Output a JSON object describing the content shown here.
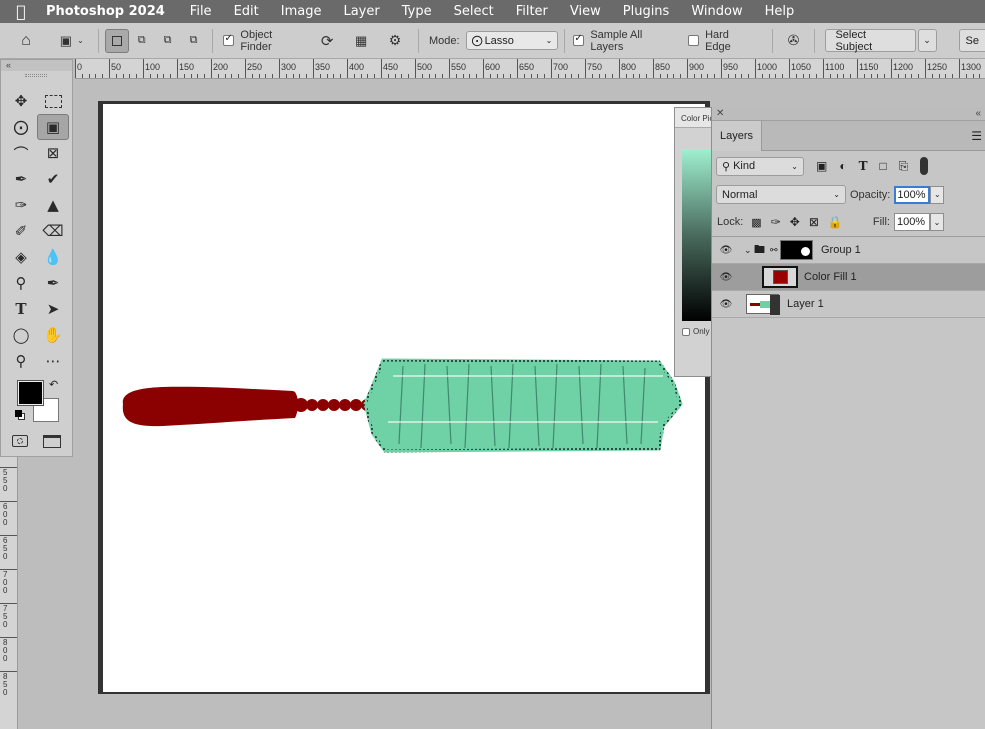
{
  "menubar": {
    "app": "Photoshop 2024",
    "items": [
      "File",
      "Edit",
      "Image",
      "Layer",
      "Type",
      "Select",
      "Filter",
      "View",
      "Plugins",
      "Window",
      "Help"
    ]
  },
  "options": {
    "object_finder_label": "Object Finder",
    "mode_label": "Mode:",
    "mode_value": "Lasso",
    "sample_all_layers_label": "Sample All Layers",
    "hard_edge_label": "Hard Edge",
    "select_subject_label": "Select Subject",
    "se_label": "Se"
  },
  "ruler": {
    "top_labels": [
      "0",
      "50",
      "100",
      "150",
      "200",
      "250",
      "300",
      "350",
      "400",
      "450",
      "500",
      "550",
      "600",
      "650",
      "700",
      "750",
      "800",
      "850",
      "900",
      "950",
      "1000",
      "1050",
      "1100",
      "1150",
      "1200",
      "1250",
      "1300"
    ],
    "left_labels": [
      "5 5 0",
      "6 0 0",
      "6 5 0",
      "7 0 0",
      "7 5 0",
      "8 0 0",
      "8 5 0"
    ]
  },
  "color_picker": {
    "title": "Color Picker",
    "only_label": "Only"
  },
  "layers": {
    "tab": "Layers",
    "kind_label": "Kind",
    "blend_mode": "Normal",
    "opacity_label": "Opacity:",
    "opacity_value": "100%",
    "lock_label": "Lock:",
    "fill_label": "Fill:",
    "fill_value": "100%",
    "rows": [
      {
        "name": "Group 1"
      },
      {
        "name": "Color Fill 1"
      },
      {
        "name": "Layer 1"
      }
    ]
  },
  "colors": {
    "brush_handle": "#8b0000",
    "bristles": "#6fd1a6",
    "fill_swatch": "#9a0000"
  }
}
